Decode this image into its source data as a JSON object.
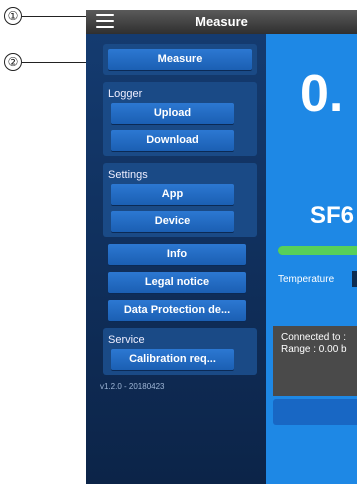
{
  "callouts": [
    "①",
    "②"
  ],
  "header": {
    "title": "Measure",
    "menu_icon": "hamburger-icon"
  },
  "drawer": {
    "measure_label": "Measure",
    "logger": {
      "title": "Logger",
      "upload": "Upload",
      "download": "Download"
    },
    "settings": {
      "title": "Settings",
      "app": "App",
      "device": "Device"
    },
    "info": "Info",
    "legal_notice": "Legal notice",
    "data_protection": "Data Protection de...",
    "service": {
      "title": "Service",
      "calibration": "Calibration req..."
    },
    "version": "v1.2.0 - 20180423"
  },
  "main": {
    "value": "0.",
    "gas": "SF6",
    "temperature_label": "Temperature",
    "connected_to": "Connected to :",
    "range": "Range : 0.00 b"
  },
  "colors": {
    "drawer_bg": "#0f2d58",
    "button": "#1e6cc8",
    "main_bg": "#1e88e5",
    "progress": "#57d05a"
  }
}
